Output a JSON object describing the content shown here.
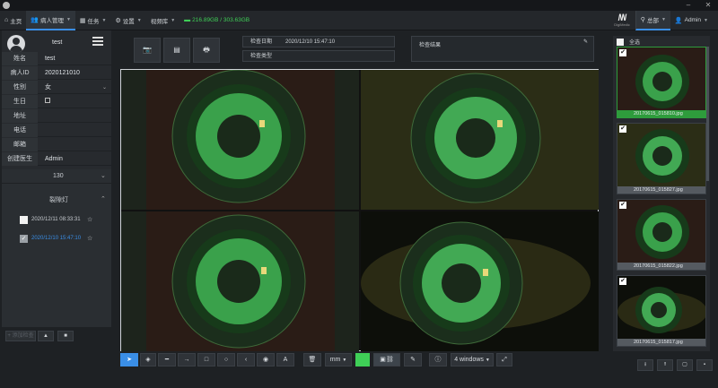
{
  "menubar": {
    "items": [
      {
        "icon": "home-icon",
        "label": "主页",
        "active": false,
        "chevron": false
      },
      {
        "icon": "users-icon",
        "label": "病人管理",
        "active": true,
        "chevron": true
      },
      {
        "icon": "tasks-icon",
        "label": "任务",
        "active": false,
        "chevron": true
      },
      {
        "icon": "gear-icon",
        "label": "设置",
        "active": false,
        "chevron": true
      },
      {
        "icon": "",
        "label": "视频库",
        "active": false,
        "chevron": true
      }
    ],
    "disk": "216.89GB / 303.63GB",
    "brand": "DigiMedic",
    "location_label": "总部",
    "user_label": "Admin"
  },
  "patient": {
    "header_name": "test",
    "fields": [
      {
        "label": "姓名",
        "value": "test"
      },
      {
        "label": "病人ID",
        "value": "2020121010"
      },
      {
        "label": "性别",
        "value": "女",
        "dropdown": true
      },
      {
        "label": "生日",
        "value": "",
        "calendar": true
      },
      {
        "label": "地址",
        "value": ""
      },
      {
        "label": "电话",
        "value": ""
      },
      {
        "label": "邮箱",
        "value": ""
      },
      {
        "label": "创建医生",
        "value": "Admin"
      }
    ]
  },
  "exam_list": {
    "count": "130",
    "group_label": "裂隙灯",
    "entries": [
      {
        "datetime": "2020/12/11 08:33:31",
        "checked": false
      },
      {
        "datetime": "2020/12/10 15:47:10",
        "checked": true
      }
    ]
  },
  "left_buttons": [
    "+ 添加检查",
    "▲",
    "■"
  ],
  "toolbar_top": {
    "btn1": "📷",
    "btn2": "▤",
    "btn3": "🖶"
  },
  "exam_info": {
    "date_label": "检查日期",
    "date_value": "2020/12/10 15:47:10",
    "type_label": "检查类型",
    "result_label": "检查结果"
  },
  "bottom_toolbar": {
    "unit": "mm",
    "layout": "4 windows"
  },
  "thumbnails": {
    "select_all": "全选",
    "items": [
      {
        "caption": "20170615_015810.jpg",
        "selected": true
      },
      {
        "caption": "20170615_015827.jpg",
        "selected": false
      },
      {
        "caption": "20170615_015822.jpg",
        "selected": false
      },
      {
        "caption": "20170615_015817.jpg",
        "selected": false
      }
    ]
  },
  "colors": {
    "accent": "#3a8ee6",
    "green": "#2e9c3c",
    "disk": "#3fcf57"
  }
}
